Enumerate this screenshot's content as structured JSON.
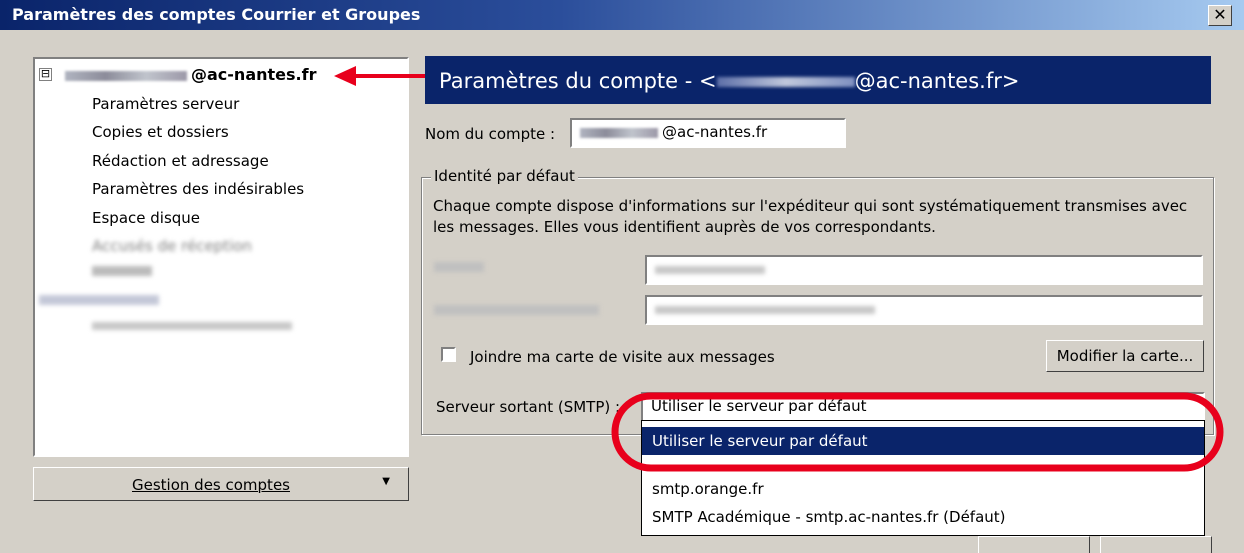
{
  "window": {
    "title": "Paramètres des comptes Courrier et Groupes",
    "close_glyph": "✕"
  },
  "tree": {
    "account_label": "@ac-nantes.fr",
    "toggle": "⊟",
    "items": [
      "Paramètres serveur",
      "Copies et dossiers",
      "Rédaction et adressage",
      "Paramètres des indésirables",
      "Espace disque",
      "Accusés de réception"
    ]
  },
  "accounts_button": {
    "label": "Gestion des comptes",
    "arrow": "▼"
  },
  "header": {
    "prefix": "Paramètres du compte - <",
    "suffix": "@ac-nantes.fr>"
  },
  "account_name": {
    "label": "Nom du compte :",
    "value": "@ac-nantes.fr"
  },
  "identity": {
    "legend": "Identité par défaut",
    "description": "Chaque compte dispose d'informations sur l'expéditeur qui sont systématiquement transmises avec les messages. Elles vous identifient auprès de vos correspondants."
  },
  "vcard": {
    "label": "Joindre ma carte de visite aux messages",
    "checked": false,
    "button": "Modifier la carte..."
  },
  "smtp": {
    "label": "Serveur sortant (SMTP) :",
    "selected": "Utiliser le serveur par défaut",
    "options": [
      "Utiliser le serveur par défaut",
      "smtp.orange.fr",
      "SMTP Académique - smtp.ac-nantes.fr (Défaut)"
    ]
  },
  "colors": {
    "selection": "#0a246a",
    "annotation_red": "#e8001c"
  }
}
